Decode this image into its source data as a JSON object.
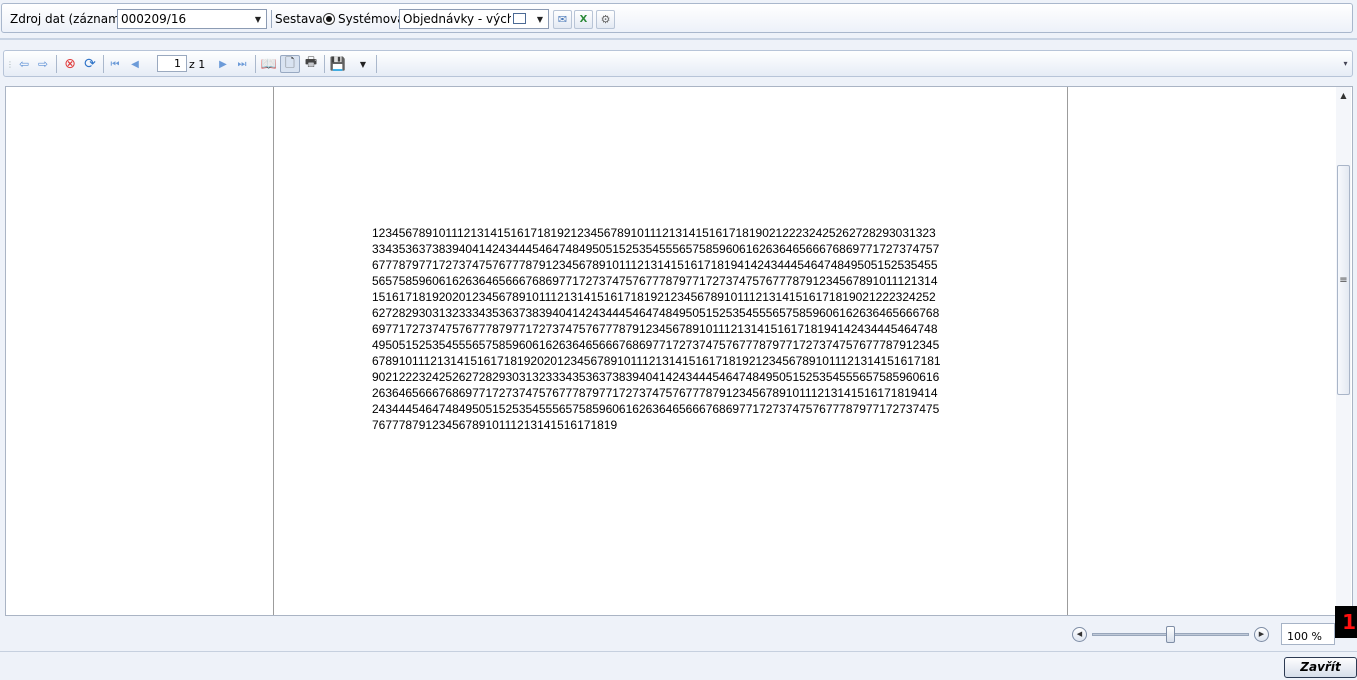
{
  "params": {
    "source_label": "Zdroj dat (záznam):",
    "source_value": "000209/16",
    "report_label": "Sestava:",
    "radio_label": "Systémová",
    "report_value": "Objednávky - vých..."
  },
  "toolbar": {
    "page_current": "1",
    "page_of": "z 1"
  },
  "document": {
    "text": "12345678910111213141516171819212345678910111213141516171819021222324252627282930313233343536373839404142434445464748495051525354555657585960616263646566676869771727374757677787977172737475767778791234567891011121314151617181941424344454647484950515253545556575859606162636465666768697717273747576777879771727374757677787912345678910111213141516171819202012345678910111213141516171819212345678910111213141516171819021222324252627282930313233343536373839404142434445464748495051525354555657585960616263646566676869771727374757677787977172737475767778791234567891011121314151617181941424344454647484950515253545556575859606162636465666768697717273747576777879771727374757677787912345678910111213141516171819202012345678910111213141516171819212345678910111213141516171819021222324252627282930313233343536373839404142434445464748495051525354555657585960616263646566676869771727374757677787977172737475767778791234567891011121314151617181941424344454647484950515253545556575859606162636465666768697717273747576777879771727374757677787912345678910111213141516171819"
  },
  "zoom": {
    "value": "100 %",
    "level": 0.5
  },
  "badge": "1",
  "footer": {
    "close_label": "Zavřít"
  }
}
